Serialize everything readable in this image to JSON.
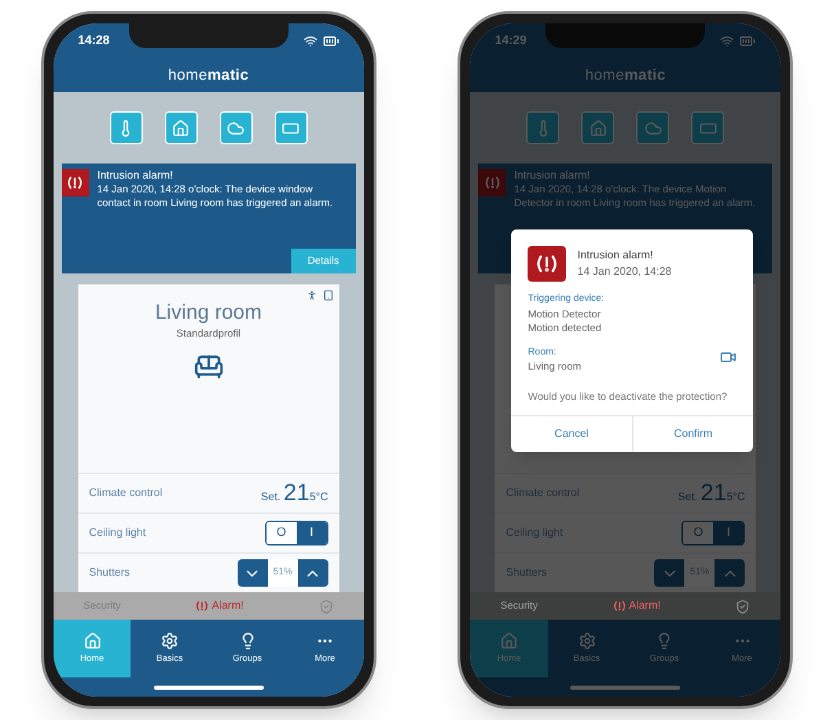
{
  "phones": [
    {
      "time": "14:28",
      "logo": {
        "light": "home",
        "bold": "matic"
      },
      "alert": {
        "title": "Intrusion alarm!",
        "message": "14 Jan 2020, 14:28 o'clock: The device window contact in room Living room has triggered an alarm.",
        "action": "Details"
      },
      "room": {
        "name": "Living room",
        "profile": "Standardprofil"
      },
      "controls": [
        {
          "kind": "climate",
          "label": "Climate control",
          "prefix": "Set.",
          "value": "21",
          "unit": "5°C"
        },
        {
          "kind": "switch",
          "label": "Ceiling light",
          "off": "O",
          "on_label": "I",
          "on": true
        },
        {
          "kind": "shutter",
          "label": "Shutters",
          "reading": "51%"
        }
      ],
      "security": {
        "label": "Security",
        "status": "Alarm!"
      },
      "tabs": [
        {
          "label": "Home",
          "selected": true
        },
        {
          "label": "Basics",
          "selected": false
        },
        {
          "label": "Groups",
          "selected": false
        },
        {
          "label": "More",
          "selected": false
        }
      ]
    },
    {
      "time": "14:29",
      "logo": {
        "light": "home",
        "bold": "matic"
      },
      "alert": {
        "title": "Intrusion alarm!",
        "message": "14 Jan 2020, 14:28 o'clock: The device Motion Detector in room Living room has triggered an alarm."
      },
      "controls": [
        {
          "kind": "climate",
          "label": "Climate control",
          "prefix": "Set.",
          "value": "21",
          "unit": "5°C"
        },
        {
          "kind": "switch",
          "label": "Ceiling light",
          "off": "O",
          "on_label": "I",
          "on": true
        },
        {
          "kind": "shutter",
          "label": "Shutters",
          "reading": "51%"
        }
      ],
      "security": {
        "label": "Security",
        "status": "Alarm!"
      },
      "tabs": [
        {
          "label": "Home",
          "selected": true
        },
        {
          "label": "Basics",
          "selected": false
        },
        {
          "label": "Groups",
          "selected": false
        },
        {
          "label": "More",
          "selected": false
        }
      ],
      "dialog": {
        "title": "Intrusion alarm!",
        "time": "14 Jan 2020, 14:28",
        "sections": [
          {
            "kind": "device",
            "label": "Triggering device:",
            "lines": [
              "Motion Detector",
              "Motion detected"
            ]
          },
          {
            "kind": "room",
            "label": "Room:",
            "lines": [
              "Living room"
            ]
          }
        ],
        "question": "Would you like to deactivate the protection?",
        "buttons": [
          "Cancel",
          "Confirm"
        ]
      }
    }
  ]
}
